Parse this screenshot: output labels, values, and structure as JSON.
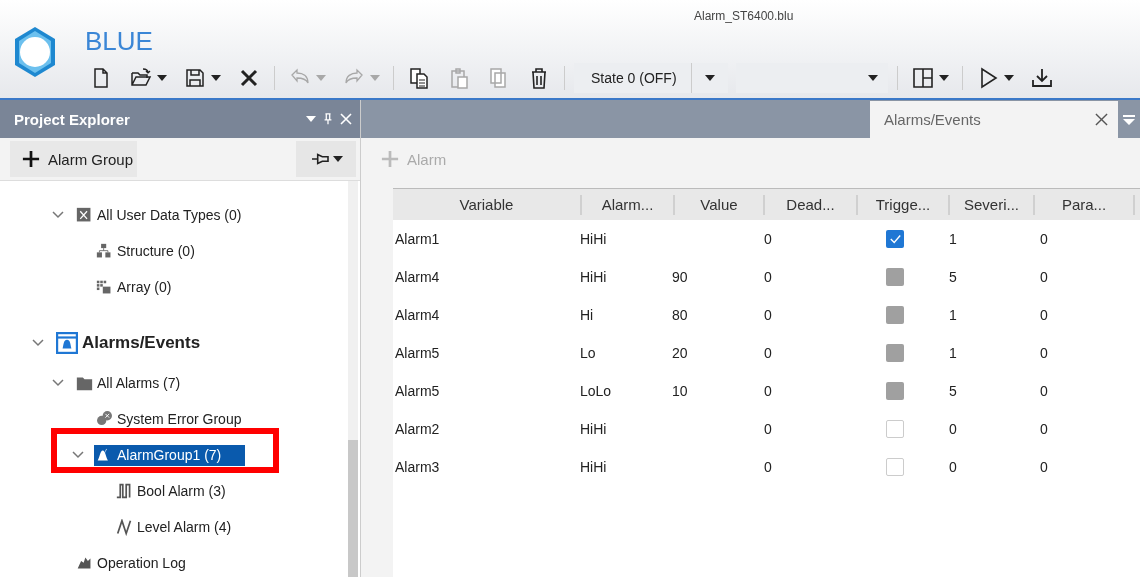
{
  "app": {
    "name": "BLUE",
    "file": "Alarm_ST6400.blu"
  },
  "toolbar": [
    {
      "kind": "button",
      "disabled": false
    },
    {
      "kind": "button",
      "disabled": false
    },
    {
      "kind": "button",
      "disabled": false
    },
    {
      "kind": "button",
      "disabled": false
    },
    {
      "kind": "separator"
    },
    {
      "kind": "button",
      "disabled": true
    },
    {
      "kind": "button",
      "disabled": true
    },
    {
      "kind": "separator"
    },
    {
      "kind": "button",
      "disabled": false
    },
    {
      "kind": "button",
      "disabled": true
    },
    {
      "kind": "button",
      "disabled": true
    },
    {
      "kind": "button",
      "disabled": false
    },
    {
      "kind": "separator"
    },
    {
      "kind": "dropdown",
      "value": "State 0 (OFF)"
    },
    {
      "kind": "dropdown"
    },
    {
      "kind": "separator"
    },
    {
      "kind": "button",
      "disabled": false
    },
    {
      "kind": "separator"
    },
    {
      "kind": "button",
      "disabled": false
    },
    {
      "kind": "button",
      "disabled": false
    }
  ],
  "project_explorer": {
    "title": "Project Explorer",
    "add_button": {
      "label": "Alarm Group",
      "disabled": false
    },
    "tree": [
      {
        "children": [
          {
            "label": "All User Data Types (0)",
            "kind": "datatype",
            "expanded": true,
            "selected": false,
            "children": [
              {
                "label": "Structure (0)",
                "kind": "structure",
                "selected": false
              },
              {
                "label": "Array (0)",
                "kind": "array",
                "selected": false
              }
            ]
          }
        ]
      },
      {
        "label": "Alarms/Events",
        "kind": "category",
        "expanded": true,
        "selected": false,
        "children": [
          {
            "label": "All Alarms (7)",
            "kind": "folder",
            "expanded": true,
            "selected": false,
            "children": [
              {
                "label": "System Error Group",
                "kind": "errorgroup",
                "selected": false
              },
              {
                "label": "AlarmGroup1 (7)",
                "kind": "alarmgroup",
                "expanded": true,
                "selected": true,
                "highlighted": true,
                "children": [
                  {
                    "label": "Bool Alarm (3)",
                    "kind": "bool",
                    "selected": false
                  },
                  {
                    "label": "Level Alarm (4)",
                    "kind": "level",
                    "selected": false
                  }
                ]
              }
            ]
          },
          {
            "label": "Operation Log",
            "kind": "log",
            "selected": false
          }
        ]
      }
    ]
  },
  "tabs": [
    {
      "label": "Alarms/Events",
      "selected": true
    }
  ],
  "editor": {
    "add_button": {
      "label": "Alarm",
      "disabled": true
    },
    "table": {
      "columns": [
        "Variable",
        "Alarm...",
        "Value",
        "Dead...",
        "Trigge...",
        "Severi...",
        "Para..."
      ],
      "rows": [
        {
          "variable": "Alarm1",
          "alarm": "HiHi",
          "dead": "0",
          "trigger": {
            "checked": true,
            "disabled": false
          },
          "severity": "1",
          "para": "0"
        },
        {
          "variable": "Alarm4",
          "alarm": "HiHi",
          "value": "90",
          "dead": "0",
          "trigger": {
            "checked": false,
            "disabled": true
          },
          "severity": "5",
          "para": "0"
        },
        {
          "variable": "Alarm4",
          "alarm": "Hi",
          "value": "80",
          "dead": "0",
          "trigger": {
            "checked": false,
            "disabled": true
          },
          "severity": "1",
          "para": "0"
        },
        {
          "variable": "Alarm5",
          "alarm": "Lo",
          "value": "20",
          "dead": "0",
          "trigger": {
            "checked": false,
            "disabled": true
          },
          "severity": "1",
          "para": "0"
        },
        {
          "variable": "Alarm5",
          "alarm": "LoLo",
          "value": "10",
          "dead": "0",
          "trigger": {
            "checked": false,
            "disabled": true
          },
          "severity": "5",
          "para": "0"
        },
        {
          "variable": "Alarm2",
          "alarm": "HiHi",
          "dead": "0",
          "trigger": {
            "checked": false,
            "disabled": false
          },
          "severity": "0",
          "para": "0"
        },
        {
          "variable": "Alarm3",
          "alarm": "HiHi",
          "dead": "0",
          "trigger": {
            "checked": false,
            "disabled": false
          },
          "severity": "0",
          "para": "0"
        }
      ]
    }
  }
}
